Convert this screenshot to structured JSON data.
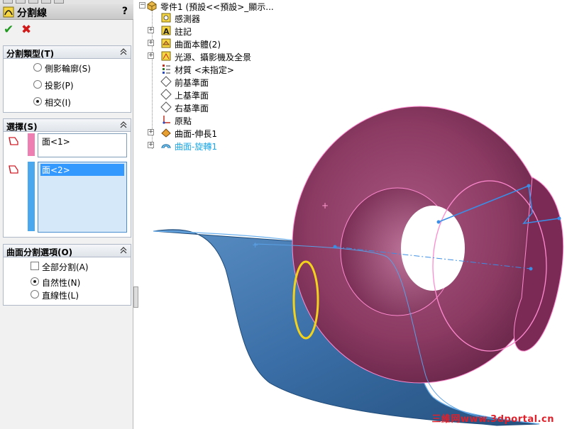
{
  "property_manager": {
    "title": "分割線",
    "help": "?",
    "ok_symbol": "✔",
    "cancel_symbol": "✖",
    "split_type": {
      "header": "分割類型(T)",
      "options": [
        {
          "label": "側影輪廓(S)",
          "selected": false
        },
        {
          "label": "投影(P)",
          "selected": false
        },
        {
          "label": "相交(I)",
          "selected": true
        }
      ]
    },
    "selections": {
      "header": "選擇(S)",
      "list1": {
        "item": "面<1>",
        "color": "#ee7fb2"
      },
      "list2": {
        "item": "面<2>",
        "color": "#4aa8ee"
      }
    },
    "surface_options": {
      "header": "曲面分割選項(O)",
      "split_all": {
        "label": "全部分割(A)",
        "checked": false
      },
      "options": [
        {
          "label": "自然性(N)",
          "selected": true
        },
        {
          "label": "直線性(L)",
          "selected": false
        }
      ]
    }
  },
  "feature_tree": {
    "root": "零件1 (預設<<預設>_顯示...",
    "items": [
      {
        "label": "感測器",
        "icon": "sensor-icon",
        "expandable": false
      },
      {
        "label": "註記",
        "icon": "annotation-icon",
        "expandable": true
      },
      {
        "label": "曲面本體(2)",
        "icon": "surface-bodies-icon",
        "expandable": true
      },
      {
        "label": "光源、攝影機及全景",
        "icon": "lights-camera-icon",
        "expandable": true
      },
      {
        "label": "材質 <未指定>",
        "icon": "material-icon",
        "expandable": false
      },
      {
        "label": "前基準面",
        "icon": "plane-icon",
        "expandable": false
      },
      {
        "label": "上基準面",
        "icon": "plane-icon",
        "expandable": false
      },
      {
        "label": "右基準面",
        "icon": "plane-icon",
        "expandable": false
      },
      {
        "label": "原點",
        "icon": "origin-icon",
        "expandable": false
      },
      {
        "label": "曲面-伸長1",
        "icon": "surface-extrude-icon",
        "expandable": true
      },
      {
        "label": "曲面-旋轉1",
        "icon": "surface-revolve-icon",
        "expandable": true,
        "highlight_color": "#1aa7e6"
      }
    ]
  },
  "watermark": "三維网www.3dportal.cn",
  "colors": {
    "torus": "#8b3a62",
    "extrude_surface": "#3b6fa8",
    "split_line": "#f2d21a"
  }
}
